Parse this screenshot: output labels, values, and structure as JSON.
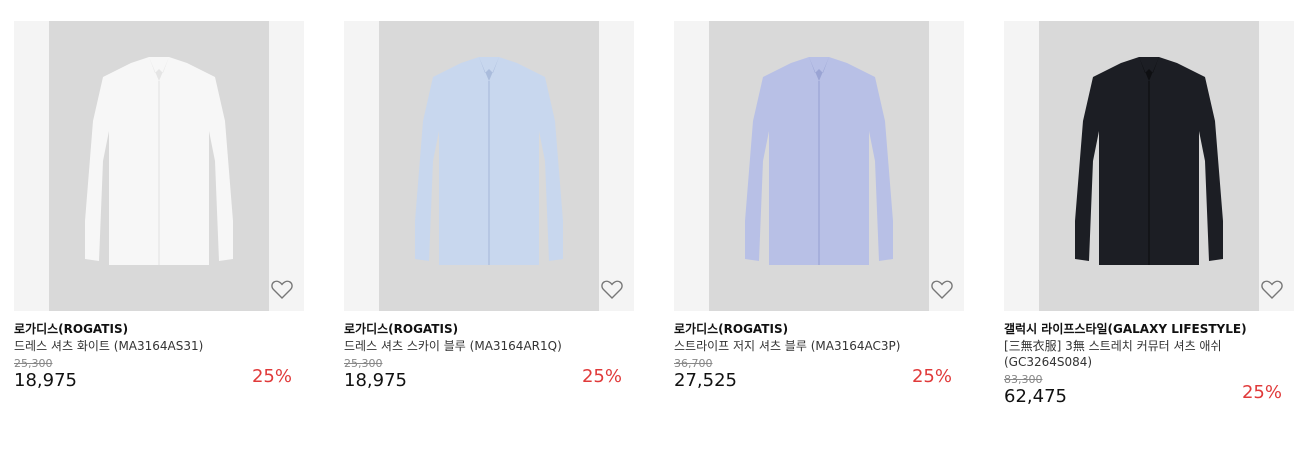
{
  "products": [
    {
      "brand": "로가디스(ROGATIS)",
      "name": "드레스 셔츠 화이트 (MA3164AS31)",
      "original_price": "25,300",
      "sale_price": "18,975",
      "discount": "25%",
      "shirt_color": "#f7f7f7",
      "shadow_color": "#e5e5e5"
    },
    {
      "brand": "로가디스(ROGATIS)",
      "name": "드레스 셔츠 스카이 블루 (MA3164AR1Q)",
      "original_price": "25,300",
      "sale_price": "18,975",
      "discount": "25%",
      "shirt_color": "#c8d7ee",
      "shadow_color": "#aabcdc"
    },
    {
      "brand": "로가디스(ROGATIS)",
      "name": "스트라이프 저지 셔츠 블루 (MA3164AC3P)",
      "original_price": "36,700",
      "sale_price": "27,525",
      "discount": "25%",
      "shirt_color": "#b8c0e6",
      "shadow_color": "#9aa4d4"
    },
    {
      "brand": "갤럭시 라이프스타일(GALAXY LIFESTYLE)",
      "name": "[三無衣服] 3無 스트레치 커뮤터 셔츠 애쉬 (GC3264S084)",
      "original_price": "83,300",
      "sale_price": "62,475",
      "discount": "25%",
      "shirt_color": "#1c1e24",
      "shadow_color": "#0e0f12"
    }
  ],
  "icons": {
    "wishlist": "heart-outline-icon"
  },
  "colors": {
    "discount": "#e03a3a"
  }
}
